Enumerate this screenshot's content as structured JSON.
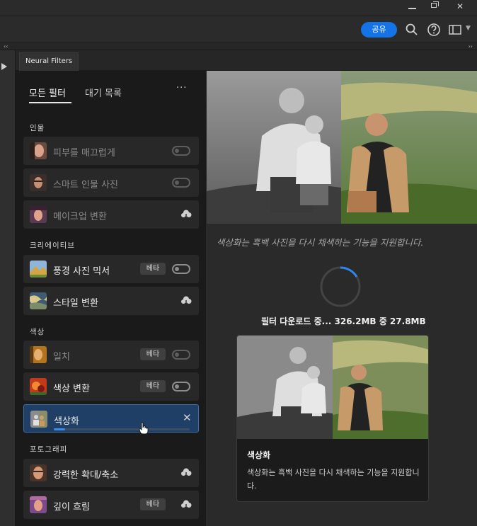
{
  "window": {
    "minimize_icon": "minimize-icon",
    "restore_icon": "restore-icon",
    "close_glyph": "✕"
  },
  "optionsbar": {
    "share_label": "공유",
    "icons": [
      "search-icon",
      "help-icon",
      "panel-layout-icon",
      "chevron-down-icon"
    ]
  },
  "strip": {
    "left_glyph": "‹‹",
    "right_glyph": "››"
  },
  "tab": {
    "label": "Neural Filters"
  },
  "filters": {
    "tab_all": "모든 필터",
    "tab_waitlist": "대기 목록",
    "more": "···",
    "categories": {
      "portrait": "인물",
      "creative": "크리에이티브",
      "color": "색상",
      "photography": "포토그래피"
    },
    "items": [
      {
        "label": "피부를 매끄럽게",
        "state": "disabled",
        "control": "toggle"
      },
      {
        "label": "스마트 인물 사진",
        "state": "disabled",
        "control": "toggle"
      },
      {
        "label": "메이크업 변환",
        "state": "disabled",
        "control": "cloud"
      },
      {
        "label": "풍경 사진 믹서",
        "beta": "베타",
        "control": "toggle"
      },
      {
        "label": "스타일 변환",
        "control": "cloud"
      },
      {
        "label": "일치",
        "state": "disabled",
        "beta": "베타",
        "control": "toggle"
      },
      {
        "label": "색상 변환",
        "beta": "베타",
        "control": "toggle"
      },
      {
        "label": "색상화",
        "state": "active",
        "control": "close",
        "close_glyph": "✕",
        "progress": 0.085
      },
      {
        "label": "강력한 확대/축소",
        "control": "cloud"
      },
      {
        "label": "깊이 흐림",
        "beta": "베타",
        "control": "cloud"
      }
    ]
  },
  "preview": {
    "description": "색상화는 흑백 사진을 다시 채색하는 기능을 지원합니다.",
    "download_text": "필터 다운로드 중... 326.2MB 중 27.8MB",
    "card_title": "색상화",
    "card_desc": "색상화는 흑백 사진을 다시 채색하는 기능을 지원합니다."
  },
  "colors": {
    "accent": "#1473e6",
    "active_row": "#1f3f66",
    "progress": "#3b8de8"
  }
}
